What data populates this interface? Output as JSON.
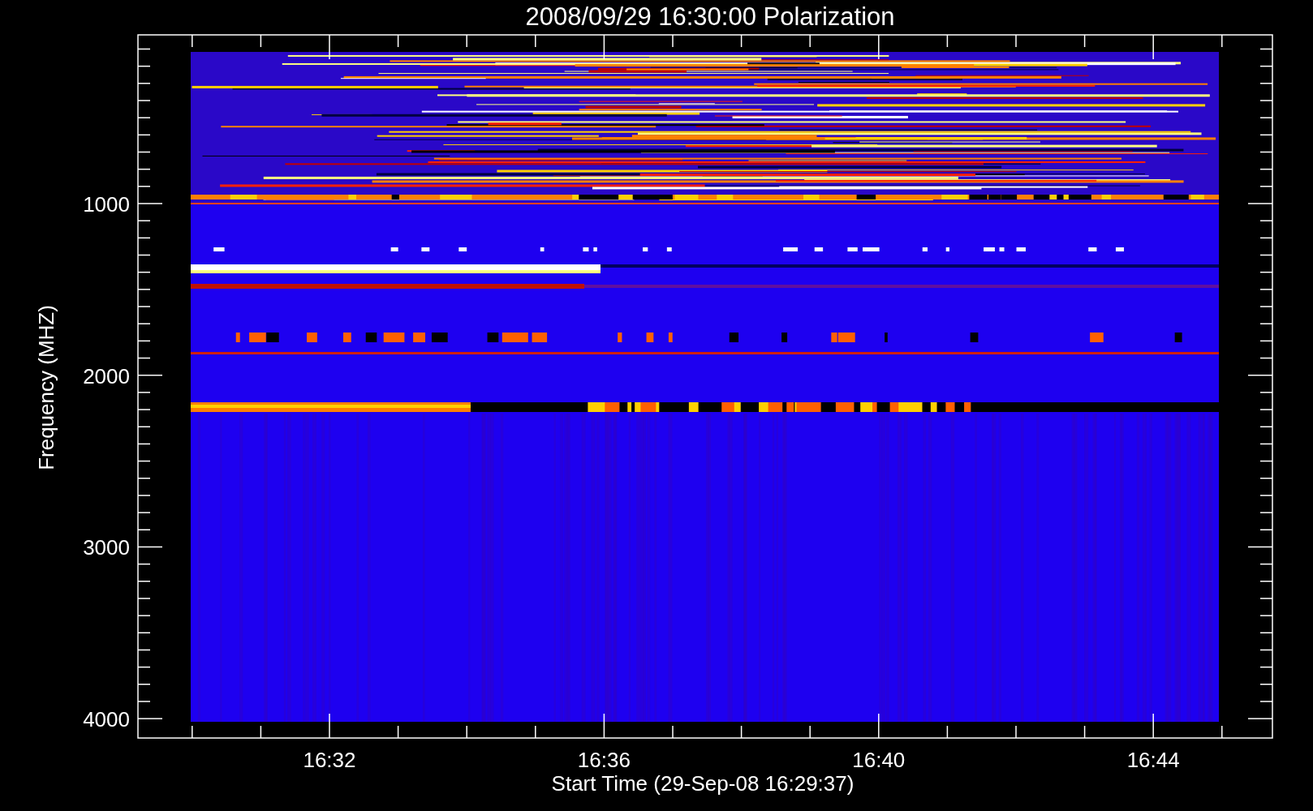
{
  "title": "2008/09/29 16:30:00 Polarization",
  "y_axis": {
    "label": "Frequency (MHZ)",
    "ticks": [
      "1000",
      "2000",
      "3000",
      "4000"
    ]
  },
  "x_axis": {
    "label": "Start Time (29-Sep-08 16:29:37)",
    "ticks": [
      "16:32",
      "16:36",
      "16:40",
      "16:44"
    ]
  }
}
